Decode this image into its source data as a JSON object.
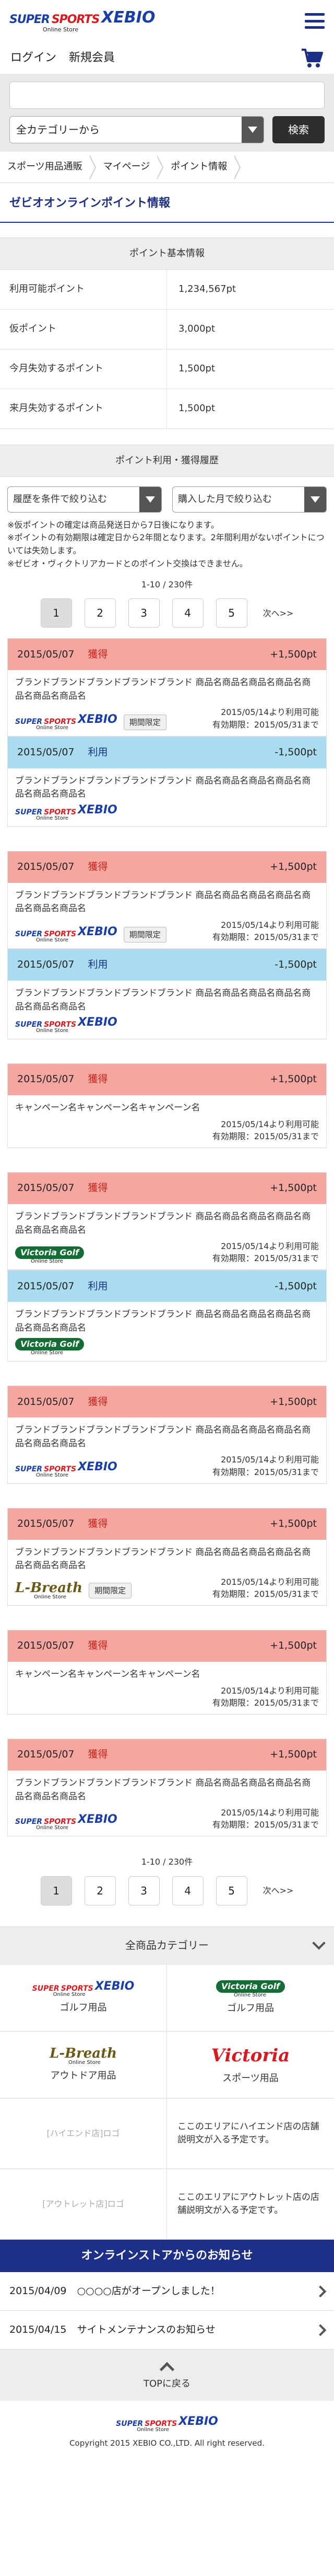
{
  "header": {
    "logo_super": "SUPER",
    "logo_sports": "SPORTS",
    "logo_brand": "XEBIO",
    "logo_store": "Online Store",
    "icons": {
      "menu": "hamburger-menu-icon",
      "cart": "cart-icon"
    },
    "login": "ログイン",
    "signup": "新規会員"
  },
  "search": {
    "input_value": "",
    "category_value": "全カテゴリーから",
    "search_button": "検索"
  },
  "breadcrumb": [
    "スポーツ用品通販",
    "マイページ",
    "ポイント情報"
  ],
  "page_title": "ゼビオオンラインポイント情報",
  "basic": {
    "heading": "ポイント基本情報",
    "rows": [
      {
        "label": "利用可能ポイント",
        "value": "1,234,567pt"
      },
      {
        "label": "仮ポイント",
        "value": "3,000pt"
      },
      {
        "label": "今月失効するポイント",
        "value": "1,500pt"
      },
      {
        "label": "来月失効するポイント",
        "value": "1,500pt"
      }
    ]
  },
  "history": {
    "heading": "ポイント利用・獲得履歴",
    "filter_history": "履歴を条件で絞り込む",
    "filter_month": "購入した月で絞り込む",
    "notes": [
      "※仮ポイントの確定は商品発送日から7日後になります。",
      "※ポイントの有効期限は確定日から2年間となります。2年間利用がないポイントについては失効します。",
      "※ゼビオ・ヴィクトリアカードとのポイント交換はできません。"
    ],
    "count": "1-10 / 230件",
    "pages": [
      "1",
      "2",
      "3",
      "4",
      "5"
    ],
    "next": "次へ>>",
    "limited_label": "期間限定",
    "groups": [
      {
        "entries": [
          {
            "type": "earn",
            "date": "2015/05/07",
            "kind": "獲得",
            "points": "+1,500pt",
            "text": "ブランドブランドブランドブランドブランド 商品名商品名商品名商品名商品名商品名商品名",
            "store": "xebio",
            "limited": true,
            "available": "2015/05/14より利用可能",
            "expires": "有効期限：2015/05/31まで"
          },
          {
            "type": "use",
            "date": "2015/05/07",
            "kind": "利用",
            "points": "-1,500pt",
            "text": "ブランドブランドブランドブランドブランド 商品名商品名商品名商品名商品名商品名商品名",
            "store": "xebio",
            "limited": false,
            "available": "",
            "expires": ""
          }
        ]
      },
      {
        "entries": [
          {
            "type": "earn",
            "date": "2015/05/07",
            "kind": "獲得",
            "points": "+1,500pt",
            "text": "ブランドブランドブランドブランドブランド 商品名商品名商品名商品名商品名商品名商品名",
            "store": "xebio",
            "limited": true,
            "available": "2015/05/14より利用可能",
            "expires": "有効期限：2015/05/31まで"
          },
          {
            "type": "use",
            "date": "2015/05/07",
            "kind": "利用",
            "points": "-1,500pt",
            "text": "ブランドブランドブランドブランドブランド 商品名商品名商品名商品名商品名商品名商品名",
            "store": "xebio",
            "limited": false,
            "available": "",
            "expires": ""
          }
        ]
      },
      {
        "entries": [
          {
            "type": "earn",
            "date": "2015/05/07",
            "kind": "獲得",
            "points": "+1,500pt",
            "text": "キャンペーン名キャンペーン名キャンペーン名",
            "store": "",
            "limited": false,
            "available": "2015/05/14より利用可能",
            "expires": "有効期限：2015/05/31まで"
          }
        ]
      },
      {
        "entries": [
          {
            "type": "earn",
            "date": "2015/05/07",
            "kind": "獲得",
            "points": "+1,500pt",
            "text": "ブランドブランドブランドブランドブランド 商品名商品名商品名商品名商品名商品名商品名",
            "store": "victoria_golf",
            "limited": false,
            "available": "2015/05/14より利用可能",
            "expires": "有効期限：2015/05/31まで"
          },
          {
            "type": "use",
            "date": "2015/05/07",
            "kind": "利用",
            "points": "-1,500pt",
            "text": "ブランドブランドブランドブランドブランド 商品名商品名商品名商品名商品名商品名商品名",
            "store": "victoria_golf",
            "limited": false,
            "available": "",
            "expires": ""
          }
        ]
      },
      {
        "entries": [
          {
            "type": "earn",
            "date": "2015/05/07",
            "kind": "獲得",
            "points": "+1,500pt",
            "text": "ブランドブランドブランドブランドブランド 商品名商品名商品名商品名商品名商品名商品名",
            "store": "xebio",
            "limited": false,
            "available": "2015/05/14より利用可能",
            "expires": "有効期限：2015/05/31まで"
          }
        ]
      },
      {
        "entries": [
          {
            "type": "earn",
            "date": "2015/05/07",
            "kind": "獲得",
            "points": "+1,500pt",
            "text": "ブランドブランドブランドブランドブランド 商品名商品名商品名商品名商品名商品名商品名",
            "store": "lbreath",
            "limited": true,
            "available": "2015/05/14より利用可能",
            "expires": "有効期限：2015/05/31まで"
          }
        ]
      },
      {
        "entries": [
          {
            "type": "earn",
            "date": "2015/05/07",
            "kind": "獲得",
            "points": "+1,500pt",
            "text": "キャンペーン名キャンペーン名キャンペーン名",
            "store": "",
            "limited": false,
            "available": "2015/05/14より利用可能",
            "expires": "有効期限：2015/05/31まで"
          }
        ]
      },
      {
        "entries": [
          {
            "type": "earn",
            "date": "2015/05/07",
            "kind": "獲得",
            "points": "+1,500pt",
            "text": "ブランドブランドブランドブランドブランド 商品名商品名商品名商品名商品名商品名商品名",
            "store": "xebio",
            "limited": false,
            "available": "2015/05/14より利用可能",
            "expires": "有効期限：2015/05/31まで"
          }
        ]
      }
    ]
  },
  "stores": {
    "xebio_super": "SUPER",
    "xebio_sports": "SPORTS",
    "xebio_brand": "XEBIO",
    "xebio_store": "Online Store",
    "victoria_golf": "Victoria Golf",
    "victoria_golf_store": "Online Store",
    "lbreath": "L-Breath",
    "lbreath_store": "Online Store",
    "victoria": "Victoria"
  },
  "categories": {
    "heading": "全商品カテゴリー",
    "cells": [
      {
        "logo": "xebio",
        "label": "ゴルフ用品"
      },
      {
        "logo": "victoria_golf",
        "label": "ゴルフ用品"
      },
      {
        "logo": "lbreath",
        "label": "アウトドア用品"
      },
      {
        "logo": "victoria",
        "label": "スポーツ用品"
      }
    ],
    "hi_end_logo": "[ハイエンド店]ロゴ",
    "hi_end_text": "ここのエリアにハイエンド店の店舗説明文が入る予定です。",
    "outlet_logo": "[アウトレット店]ロゴ",
    "outlet_text": "ここのエリアにアウトレット店の店舗説明文が入る予定です。"
  },
  "news": {
    "heading": "オンラインストアからのお知らせ",
    "items": [
      {
        "date": "2015/04/09",
        "text": "○○○○店がオープンしました！"
      },
      {
        "date": "2015/04/15",
        "text": "サイトメンテナンスのお知らせ"
      }
    ]
  },
  "footer": {
    "to_top": "TOPに戻る",
    "copyright": "Copyright 2015 XEBIO CO.,LTD. All right reserved."
  },
  "colors": {
    "brand_blue": "#1d2f86",
    "earn_bg": "#f5a6a1",
    "use_bg": "#a9dcef"
  }
}
